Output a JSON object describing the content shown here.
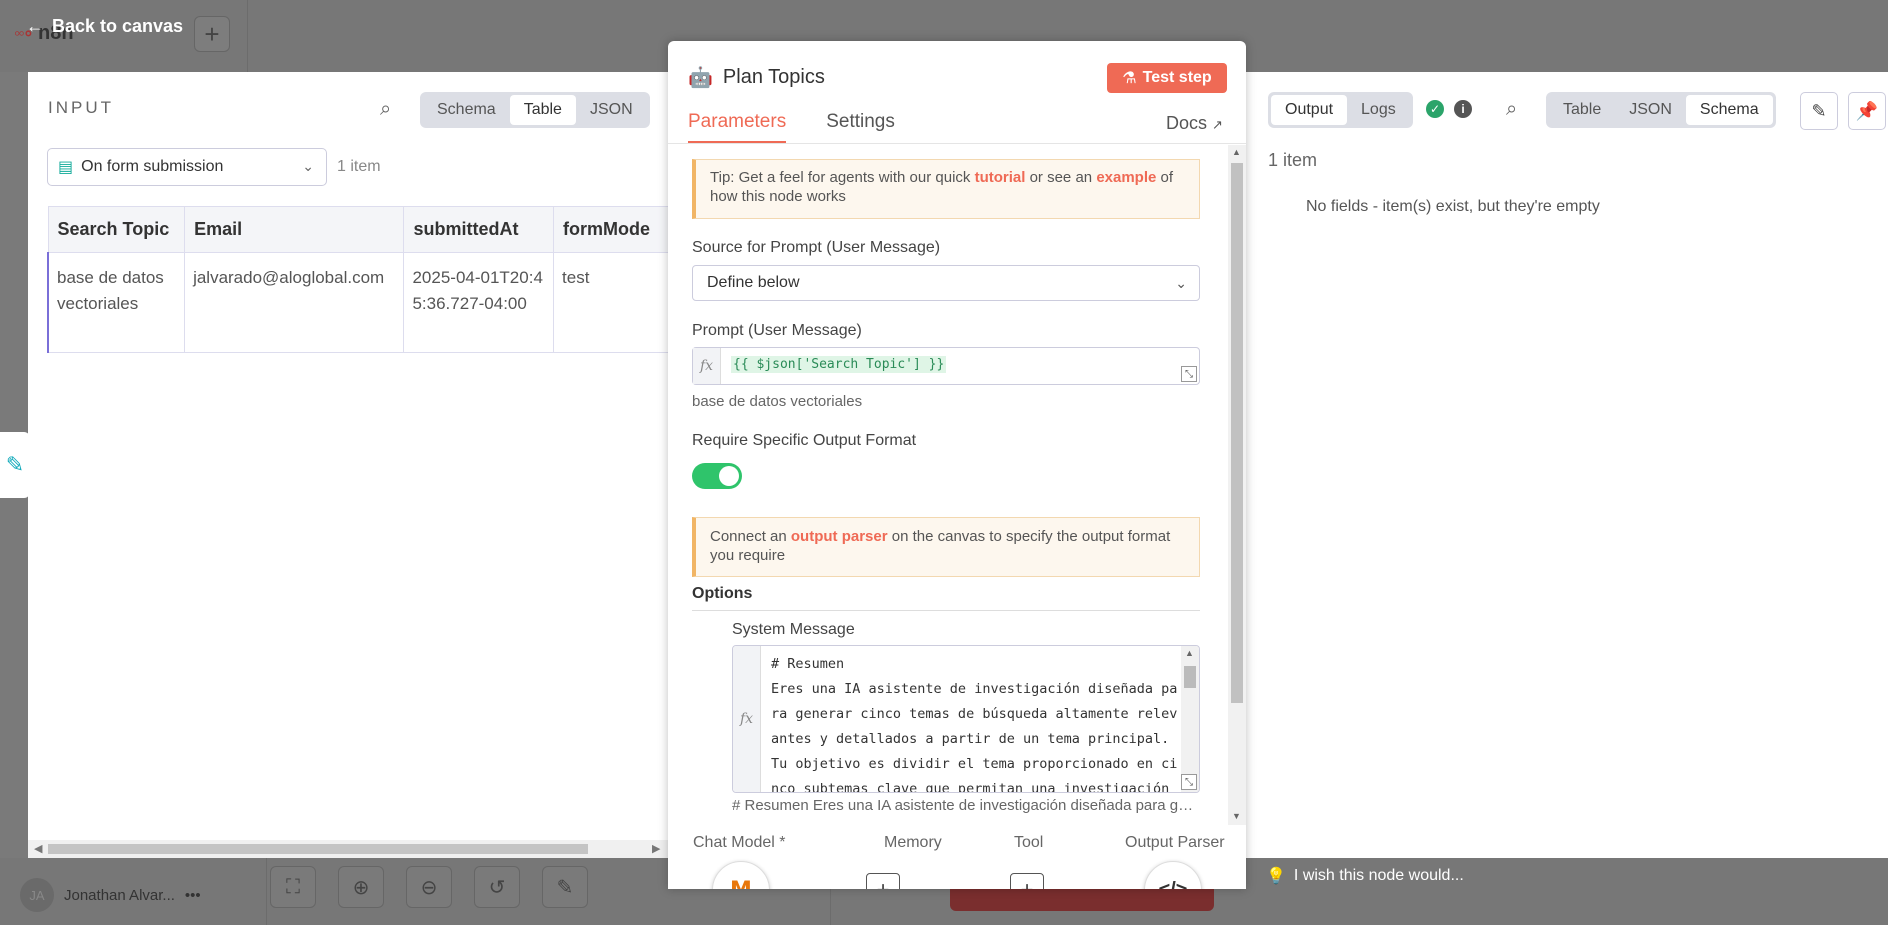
{
  "background": {
    "logo_text": "n8n",
    "back_label": "Back to canvas",
    "user_initials": "JA",
    "user_name": "Jonathan Alvar...",
    "user_menu": "•••"
  },
  "input_panel": {
    "label": "INPUT",
    "views": [
      "Schema",
      "Table",
      "JSON"
    ],
    "active_view": "Table",
    "source_node": "On form submission",
    "item_count": "1 item",
    "columns": [
      "Search Topic",
      "Email",
      "submittedAt",
      "formMode"
    ],
    "rows": [
      [
        "base de datos vectoriales",
        "jalvarado@aloglobal.com",
        "2025-04-01T20:45:36.727-04:00",
        "test"
      ]
    ]
  },
  "node": {
    "title": "Plan Topics",
    "test_button": "Test step",
    "tabs": [
      "Parameters",
      "Settings"
    ],
    "active_tab": "Parameters",
    "docs_label": "Docs",
    "tip": {
      "prefix": "Tip: Get a feel for agents with our quick ",
      "link1": "tutorial",
      "middle": " or see an ",
      "link2": "example",
      "suffix": " of how this node works"
    },
    "source_label": "Source for Prompt (User Message)",
    "source_value": "Define below",
    "prompt_label": "Prompt (User Message)",
    "prompt_expression": "{{ $json['Search Topic'] }}",
    "prompt_result": "base de datos vectoriales",
    "output_format_label": "Require Specific Output Format",
    "output_format_enabled": true,
    "notice": {
      "prefix": "Connect an ",
      "link": "output parser",
      "suffix": " on the canvas to specify the output format you require"
    },
    "options_label": "Options",
    "system_message_label": "System Message",
    "system_message": "# Resumen\nEres una IA asistente de investigación diseñada para generar cinco temas de búsqueda altamente relevantes y detallados a partir de un tema principal. Tu objetivo es dividir el tema proporcionado en cinco subtemas clave que permitan una investigación",
    "system_message_preview": "# Resumen   Eres una IA asistente de investigación diseñada para generar cinco temas de búsqueda altamente relevantes",
    "subnodes": {
      "chat_model": "Chat Model *",
      "memory": "Memory",
      "tool": "Tool",
      "output_parser": "Output Parser"
    }
  },
  "output_panel": {
    "modes": [
      "Output",
      "Logs"
    ],
    "active_mode": "Output",
    "views": [
      "Table",
      "JSON",
      "Schema"
    ],
    "active_view": "Schema",
    "item_count": "1 item",
    "empty_message": "No fields - item(s) exist, but they're empty",
    "wish_label": "I wish this node would..."
  },
  "colors": {
    "accent": "#ef6a55",
    "success": "#2fc46b",
    "tip_bg": "#fdf7ee"
  }
}
